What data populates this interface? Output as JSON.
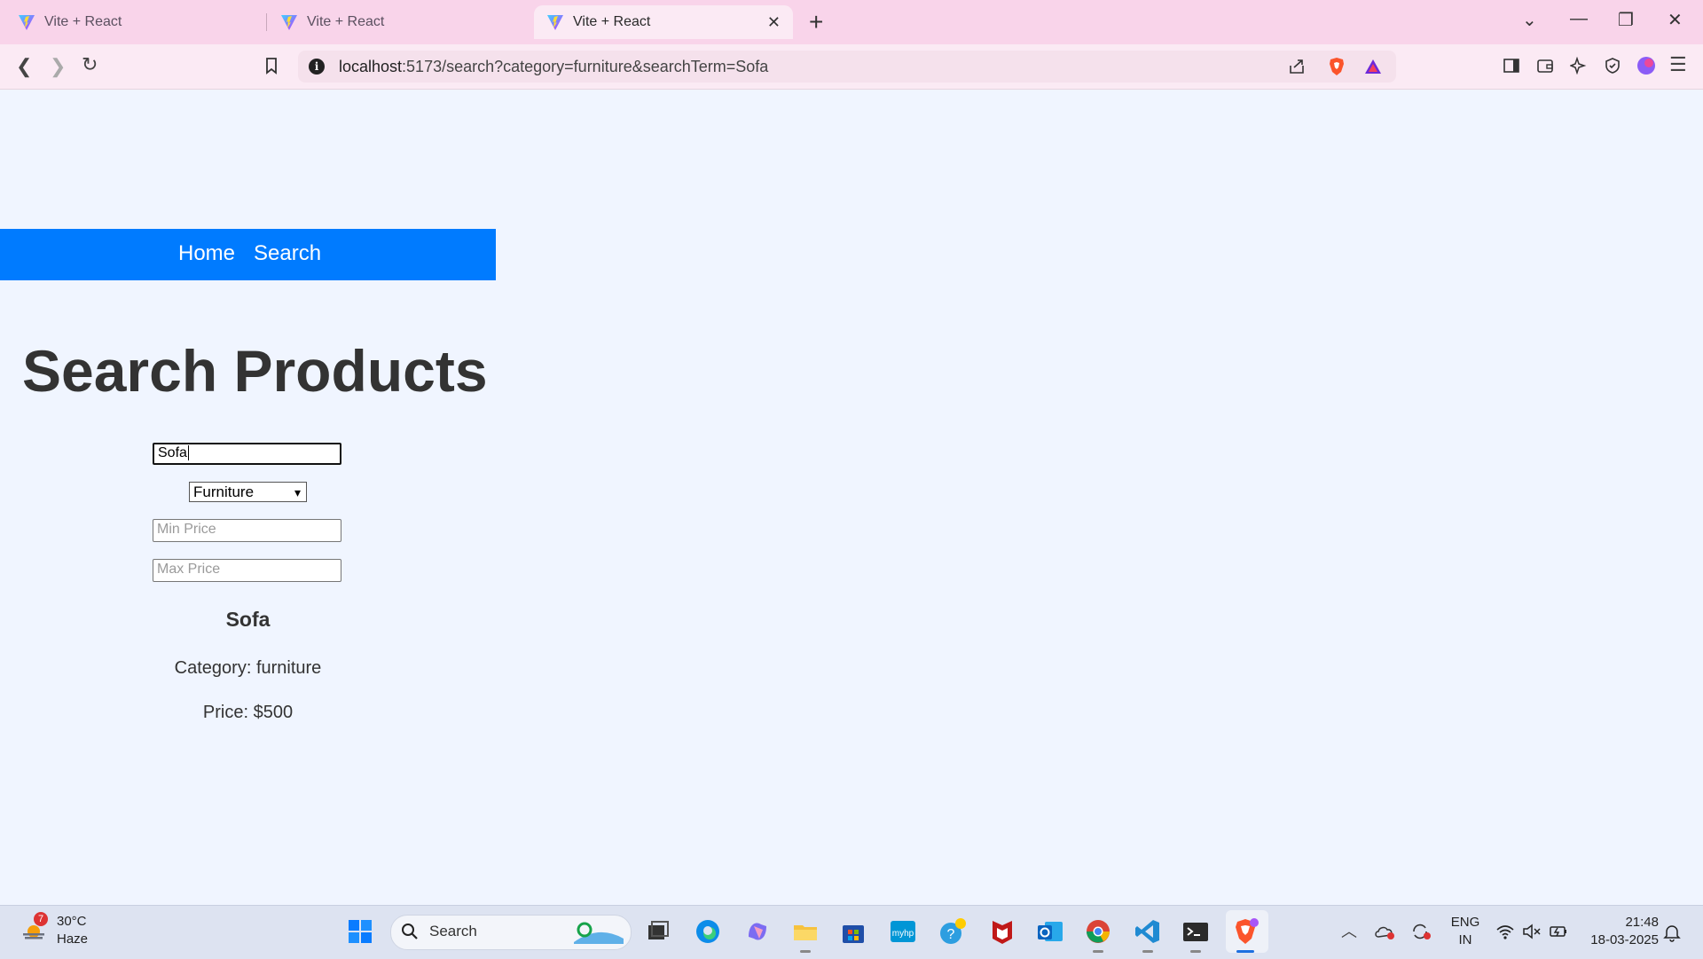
{
  "browser": {
    "tabs": [
      {
        "title": "Vite + React",
        "active": false
      },
      {
        "title": "Vite + React",
        "active": false
      },
      {
        "title": "Vite + React",
        "active": true
      }
    ],
    "url_host": "localhost",
    "url_rest": ":5173/search?category=furniture&searchTerm=Sofa"
  },
  "nav": {
    "home": "Home",
    "search": "Search"
  },
  "page": {
    "title": "Search Products",
    "search_value": "Sofa",
    "category_selected": "Furniture",
    "min_price_placeholder": "Min Price",
    "max_price_placeholder": "Max Price"
  },
  "result": {
    "name": "Sofa",
    "category": "Category: furniture",
    "price": "Price: $500"
  },
  "taskbar": {
    "weather_temp": "30°C",
    "weather_desc": "Haze",
    "weather_badge": "7",
    "search_label": "Search",
    "lang_top": "ENG",
    "lang_bottom": "IN",
    "time": "21:48",
    "date": "18-03-2025"
  },
  "colors": {
    "navbar": "#007bff",
    "page_bg": "#f0f5ff",
    "tabstrip": "#f9d4ea"
  }
}
